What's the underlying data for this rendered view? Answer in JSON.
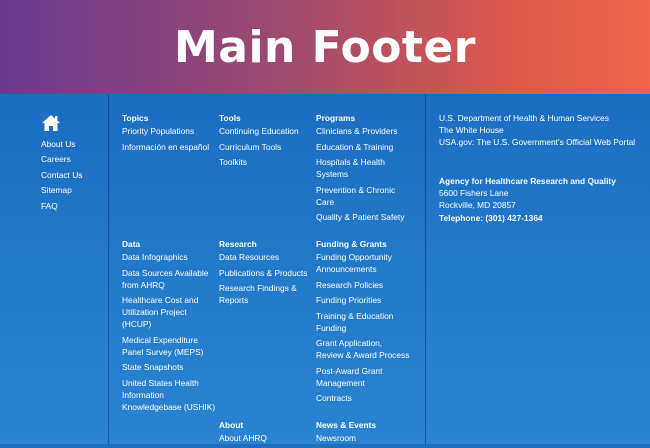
{
  "banner": {
    "title": "Main Footer"
  },
  "colors": {
    "banner_start": "#6b3a91",
    "banner_end": "#f0624a",
    "footer_bg": "#1f6fc0"
  },
  "left_nav": {
    "home_icon": "home-icon",
    "items": [
      "About Us",
      "Careers",
      "Contact Us",
      "Sitemap",
      "FAQ"
    ]
  },
  "topics": {
    "heading": "Topics",
    "items": [
      "Priority Populations",
      "Información en español"
    ]
  },
  "data": {
    "heading": "Data",
    "items": [
      "Data Infographics",
      "Data Sources Available from AHRQ",
      "Healthcare Cost and Utilization Project (HCUP)",
      "Medical Expenditure Panel Survey (MEPS)",
      "State Snapshots",
      "United States Health Information Knowledgebase (USHIK)"
    ]
  },
  "tools": {
    "heading": "Tools",
    "items": [
      "Continuing Education",
      "Curriculum Tools",
      "Toolkits"
    ]
  },
  "research": {
    "heading": "Research",
    "items": [
      "Data Resources",
      "Publications & Products",
      "Research Findings & Reports"
    ]
  },
  "about": {
    "heading": "About",
    "items": [
      "About AHRQ"
    ]
  },
  "programs": {
    "heading": "Programs",
    "items": [
      "Clinicians & Providers",
      "Education & Training",
      "Hospitals & Health Systems",
      "Prevention & Chronic Care",
      "Quality & Patient Safety"
    ]
  },
  "funding": {
    "heading": "Funding & Grants",
    "items": [
      "Funding Opportunity Announcements",
      "Research Policies",
      "Funding Priorities",
      "Training & Education Funding",
      "Grant Application, Review & Award Process",
      "Post-Award Grant Management",
      "Contracts"
    ]
  },
  "news": {
    "heading": "News & Events",
    "items": [
      "Newsroom"
    ]
  },
  "gov_links": [
    "U.S. Department of Health & Human Services",
    "The White House",
    "USA.gov: The U.S. Government's Official Web Portal"
  ],
  "agency": {
    "name": "Agency for Healthcare Research and Quality",
    "address1": "5600 Fishers Lane",
    "address2": "Rockville, MD 20857",
    "telephone": "Telephone: (301) 427-1364"
  }
}
